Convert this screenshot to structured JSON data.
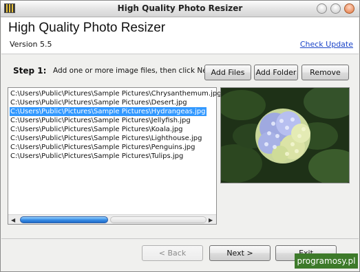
{
  "window": {
    "title": "High Quality Photo Resizer"
  },
  "header": {
    "app_title": "High Quality Photo Resizer",
    "version": "Version 5.5",
    "check_update": "Check Update"
  },
  "step": {
    "label": "Step 1:",
    "instruction": "Add one or more image files, then click Next."
  },
  "toolbar": {
    "add_files": "Add Files",
    "add_folder": "Add Folder",
    "remove": "Remove"
  },
  "files": [
    {
      "path": "C:\\Users\\Public\\Pictures\\Sample Pictures\\Chrysanthemum.jpg",
      "selected": false
    },
    {
      "path": "C:\\Users\\Public\\Pictures\\Sample Pictures\\Desert.jpg",
      "selected": false
    },
    {
      "path": "C:\\Users\\Public\\Pictures\\Sample Pictures\\Hydrangeas.jpg",
      "selected": true
    },
    {
      "path": "C:\\Users\\Public\\Pictures\\Sample Pictures\\Jellyfish.jpg",
      "selected": false
    },
    {
      "path": "C:\\Users\\Public\\Pictures\\Sample Pictures\\Koala.jpg",
      "selected": false
    },
    {
      "path": "C:\\Users\\Public\\Pictures\\Sample Pictures\\Lighthouse.jpg",
      "selected": false
    },
    {
      "path": "C:\\Users\\Public\\Pictures\\Sample Pictures\\Penguins.jpg",
      "selected": false
    },
    {
      "path": "C:\\Users\\Public\\Pictures\\Sample Pictures\\Tulips.jpg",
      "selected": false
    }
  ],
  "nav": {
    "back": "< Back",
    "next": "Next >",
    "exit": "Exit"
  },
  "watermark": "programosy.pl",
  "colors": {
    "selection": "#3399ff",
    "link": "#1a44c8"
  }
}
